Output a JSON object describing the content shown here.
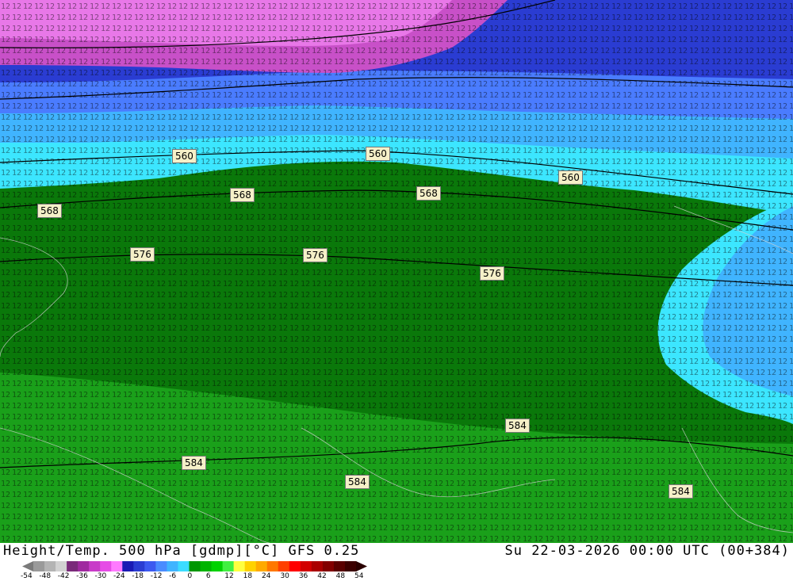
{
  "title": {
    "left": "Height/Temp. 500 hPa [gdmp][°C] GFS 0.25",
    "right": "Su 22-03-2026 00:00 UTC (00+384)"
  },
  "contour_labels": [
    "568",
    "568",
    "560",
    "560",
    "560",
    "568",
    "568",
    "576",
    "576",
    "576",
    "584",
    "584",
    "584",
    "584"
  ],
  "colorbar": {
    "ticks": [
      "-54",
      "-48",
      "-42",
      "-36",
      "-30",
      "-24",
      "-18",
      "-12",
      "-6",
      "0",
      "6",
      "12",
      "18",
      "24",
      "30",
      "36",
      "42",
      "48",
      "54"
    ],
    "colors": [
      "#9a9a9a",
      "#b4b4b4",
      "#d2d2d2",
      "#7a2a7a",
      "#a02aa0",
      "#c83cc8",
      "#e64ce6",
      "#ff7aff",
      "#1a1ab4",
      "#2a3cd2",
      "#3c5af0",
      "#4a8cff",
      "#40b4ff",
      "#3cdcff",
      "#009600",
      "#00b400",
      "#00d200",
      "#40f040",
      "#ffff40",
      "#ffd200",
      "#ffaa00",
      "#ff7800",
      "#ff4000",
      "#ff0000",
      "#d20000",
      "#aa0000",
      "#820000",
      "#5a0000",
      "#3c0000"
    ]
  },
  "colors": {
    "magenta": "#e060e0",
    "violet": "#8c46c8",
    "blue_dark": "#2a3cd2",
    "blue_mid": "#4a7cff",
    "blue_light": "#3cb4ff",
    "cyan": "#3ce6ff",
    "green_light": "#1aa01a",
    "green_dark": "#0a780a"
  }
}
